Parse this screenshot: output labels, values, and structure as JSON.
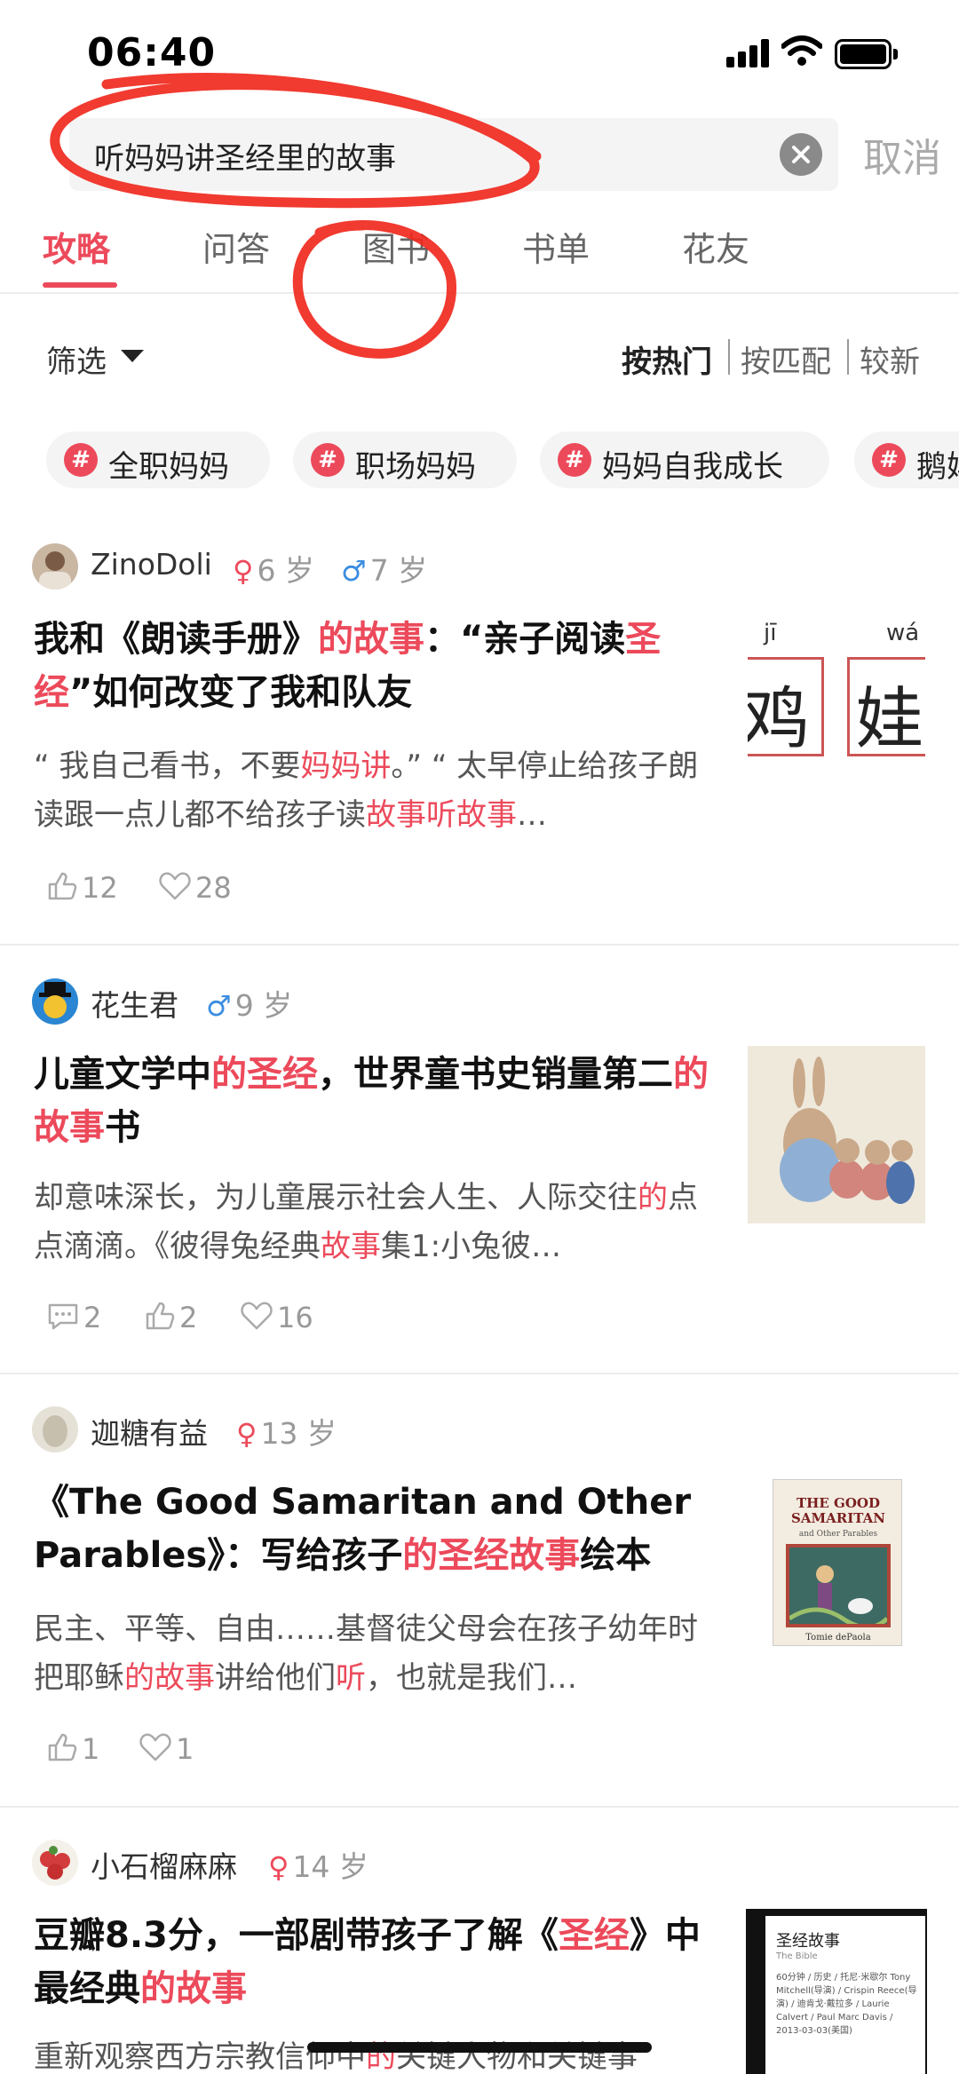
{
  "status_bar": {
    "time": "06:40"
  },
  "search": {
    "query": "听妈妈讲圣经里的故事",
    "cancel_label": "取消"
  },
  "tabs": [
    {
      "label": "攻略",
      "active": true
    },
    {
      "label": "问答"
    },
    {
      "label": "图书"
    },
    {
      "label": "书单"
    },
    {
      "label": "花友"
    }
  ],
  "filter": {
    "label": "筛选"
  },
  "sort": [
    {
      "label": "按热门",
      "active": true
    },
    {
      "label": "按匹配"
    },
    {
      "label": "较新"
    }
  ],
  "topics": [
    {
      "label": "全职妈妈"
    },
    {
      "label": "职场妈妈"
    },
    {
      "label": "妈妈自我成长"
    },
    {
      "label": "鹅妈"
    }
  ],
  "posts": [
    {
      "author": "ZinoDoli",
      "ages": [
        {
          "gender": "girl",
          "label": "6 岁"
        },
        {
          "gender": "boy",
          "label": "7 岁"
        }
      ],
      "title_parts": [
        "我和《朗读手册》",
        "的故事",
        "：“亲子阅读",
        "圣经",
        "”如何改变了我和队友"
      ],
      "excerpt_parts": [
        "“ 我自己看书，不要",
        "妈妈讲",
        "。” “ 太早停止给孩子朗读跟一点儿都不给孩子读",
        "故事听故事",
        "…"
      ],
      "thumbnail": {
        "pinyin": [
          "jī",
          "wá"
        ],
        "chars": [
          "鸡",
          "娃"
        ]
      },
      "stats": {
        "likes": "12",
        "favorites": "28"
      }
    },
    {
      "author": "花生君",
      "ages": [
        {
          "gender": "boy",
          "label": "9 岁"
        }
      ],
      "title_parts": [
        "儿童文学中",
        "的圣经",
        "，世界童书史销量第二",
        "的故事",
        "书"
      ],
      "excerpt_parts": [
        "却意味深长，为儿童展示社会人生、人际交往",
        "的",
        "点点滴滴。《彼得兔经典",
        "故事",
        "集1:小兔彼…"
      ],
      "stats": {
        "comments": "2",
        "likes": "2",
        "favorites": "16"
      }
    },
    {
      "author": "迦糖有益",
      "ages": [
        {
          "gender": "girl",
          "label": "13 岁"
        }
      ],
      "title_parts": [
        "《The Good Samaritan and Other Parables》：写给孩子",
        "的圣经故事",
        "绘本"
      ],
      "excerpt_parts": [
        "民主、平等、自由……基督徒父母会在孩子幼年时把耶稣",
        "的故事",
        "讲给他们",
        "听",
        "，也就是我们…"
      ],
      "thumbnail": {
        "book_title": "THE GOOD SAMARITAN",
        "book_subtitle": "and Other Parables",
        "book_author": "Tomie dePaola"
      },
      "stats": {
        "likes": "1",
        "favorites": "1"
      }
    },
    {
      "author": "小石榴麻麻",
      "ages": [
        {
          "gender": "girl",
          "label": "14 岁"
        }
      ],
      "title_parts": [
        "豆瓣8.3分，一部剧带孩子了解《",
        "圣经",
        "》中最经典",
        "的故事"
      ],
      "excerpt_parts": [
        "重新观察西方宗教信仰中",
        "的",
        "关键人物和关键事"
      ],
      "thumbnail": {
        "film_title": "圣经故事",
        "film_subtitle": "The Bible",
        "film_meta": "60分钟 / 历史 / 托尼·米歇尔 Tony Mitchell(导演) / Crispin Reece(导演) / 迪肯戈·戴拉多 / Laurie Calvert / Paul Marc Davis / 2013-03-03(美国)"
      }
    }
  ]
}
